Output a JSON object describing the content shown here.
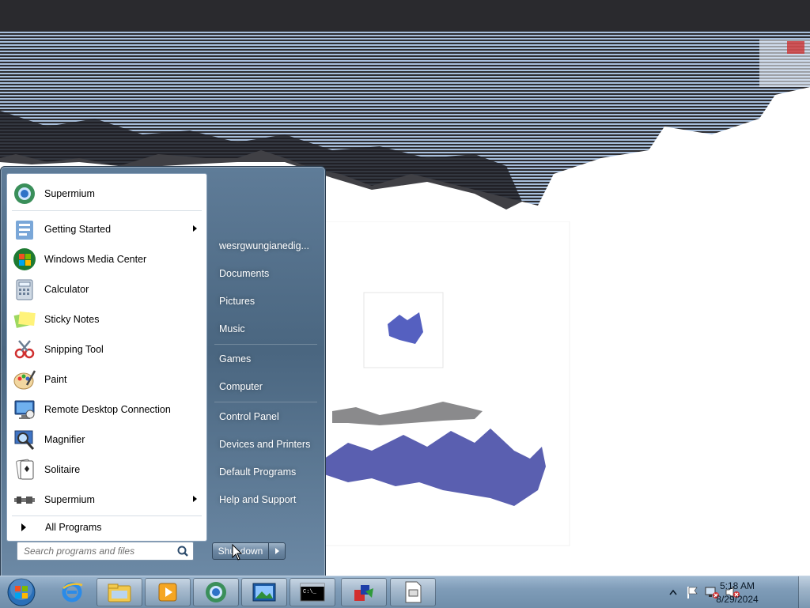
{
  "start_menu": {
    "pinned": [
      {
        "label": "Supermium",
        "icon": "supermium-icon",
        "submenu": false
      },
      {
        "label": "Getting Started",
        "icon": "getting-started-icon",
        "submenu": true
      },
      {
        "label": "Windows Media Center",
        "icon": "media-center-icon",
        "submenu": false
      },
      {
        "label": "Calculator",
        "icon": "calculator-icon",
        "submenu": false
      },
      {
        "label": "Sticky Notes",
        "icon": "sticky-notes-icon",
        "submenu": false
      },
      {
        "label": "Snipping Tool",
        "icon": "snipping-tool-icon",
        "submenu": false
      },
      {
        "label": "Paint",
        "icon": "paint-icon",
        "submenu": false
      },
      {
        "label": "Remote Desktop Connection",
        "icon": "remote-desktop-icon",
        "submenu": false
      },
      {
        "label": "Magnifier",
        "icon": "magnifier-icon",
        "submenu": false
      },
      {
        "label": "Solitaire",
        "icon": "solitaire-icon",
        "submenu": false
      },
      {
        "label": "Supermium",
        "icon": "supermium-small-icon",
        "submenu": true
      }
    ],
    "all_programs_label": "All Programs",
    "search_placeholder": "Search programs and files",
    "places": [
      "wesrgwungianedig...",
      "Documents",
      "Pictures",
      "Music",
      "Games",
      "Computer",
      "Control Panel",
      "Devices and Printers",
      "Default Programs",
      "Help and Support"
    ],
    "shutdown_label": "Shut down"
  },
  "taskbar": {
    "pinned": [
      {
        "name": "internet-explorer-icon",
        "active": false
      },
      {
        "name": "file-explorer-icon",
        "active": true
      },
      {
        "name": "media-player-icon",
        "active": true
      },
      {
        "name": "supermium-browser-icon",
        "active": true
      },
      {
        "name": "photo-viewer-icon",
        "active": true
      },
      {
        "name": "command-prompt-icon",
        "active": true
      },
      {
        "name": "shapes-app-icon",
        "active": true
      },
      {
        "name": "document-icon",
        "active": true
      }
    ],
    "tray": {
      "time": "5:18 AM",
      "date": "8/29/2024",
      "icons": [
        "show-hidden-icons-icon",
        "action-center-flag-icon",
        "network-icon",
        "volume-muted-icon"
      ]
    }
  },
  "colors": {
    "menu_frame": "#4a6680",
    "taskbar": "#7f9cb8",
    "glitch_dark": "#2a2a2e",
    "glitch_blue": "#9fb6d6",
    "glitch_purple": "#5a5fb0"
  }
}
